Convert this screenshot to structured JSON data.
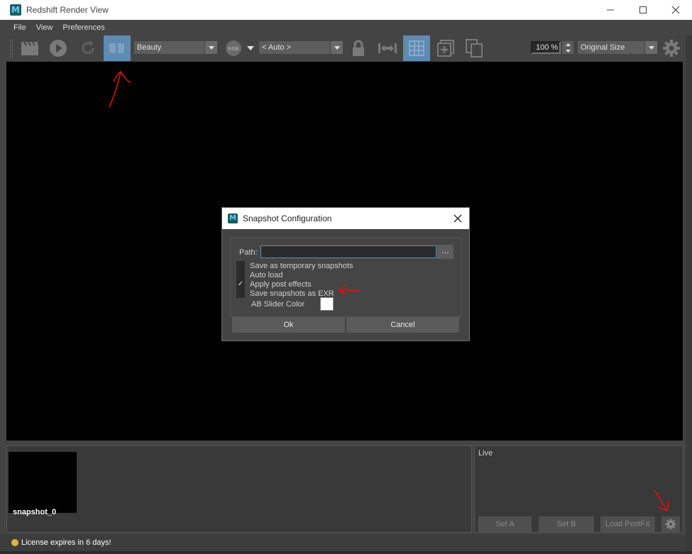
{
  "window": {
    "title": "Redshift Render View",
    "logo_letter": "M"
  },
  "menu": {
    "items": [
      "File",
      "View",
      "Preferences"
    ]
  },
  "toolbar": {
    "aov_value": "Beauty",
    "channel_badge": "RGB",
    "lut_value": "< Auto >",
    "zoom_value": "100 %",
    "size_value": "Original Size",
    "active_tool": "snapshot-compare"
  },
  "dialog": {
    "title": "Snapshot Configuration",
    "logo_letter": "M",
    "path_label": "Path:",
    "path_value": "",
    "browse_label": "...",
    "options": [
      {
        "label": "Save as temporary snapshots",
        "checked": false
      },
      {
        "label": "Auto load",
        "checked": false
      },
      {
        "label": "Apply post effects",
        "checked": true
      },
      {
        "label": "Save snapshots as EXR",
        "checked": false
      }
    ],
    "ab_slider_label": "AB Slider Color",
    "ab_slider_color": "#ffffff",
    "ok_label": "Ok",
    "cancel_label": "Cancel",
    "check_mark": "✓"
  },
  "snapshots": {
    "items": [
      {
        "label": "snapshot_0"
      }
    ]
  },
  "live": {
    "title": "Live",
    "set_a_label": "Set A",
    "set_b_label": "Set B",
    "load_postfx_label": "Load PostFX"
  },
  "status": {
    "text": "License expires in 6 days!",
    "dot_color": "#d8b640"
  },
  "colors": {
    "accent": "#5f8ab2",
    "annotation": "#e01010"
  }
}
